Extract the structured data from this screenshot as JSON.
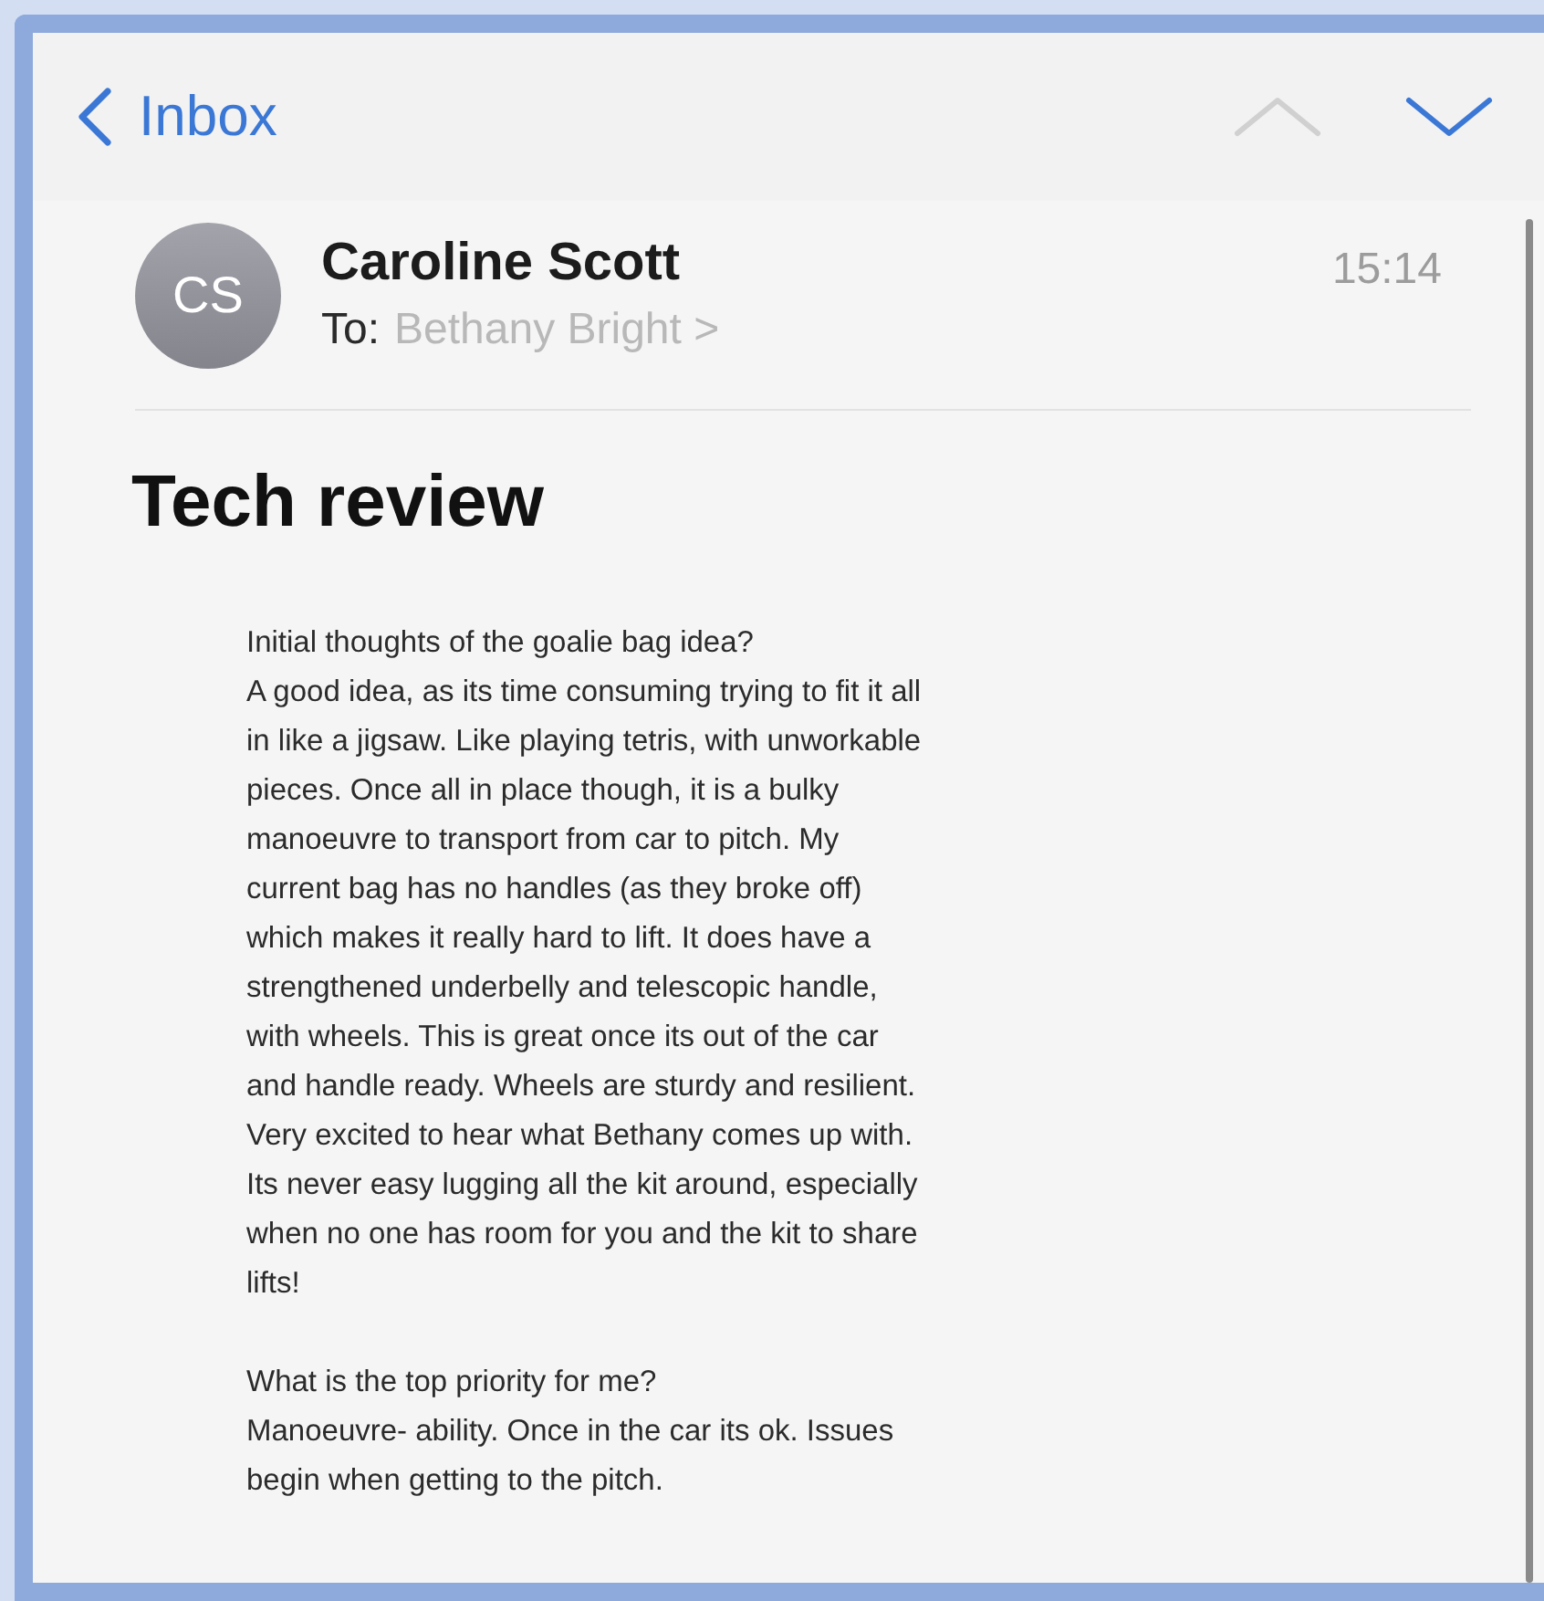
{
  "nav": {
    "back_label": "Inbox",
    "previous": {
      "disabled": true
    },
    "next": {
      "disabled": false
    }
  },
  "message": {
    "avatar_initials": "CS",
    "sender": "Caroline Scott",
    "to_label": "To:",
    "recipient": "Bethany Bright",
    "recipient_chevron": ">",
    "time": "15:14",
    "subject": "Tech review",
    "paragraphs": [
      {
        "lines": [
          "Initial thoughts of the goalie bag idea?",
          "A good idea, as its time consuming trying to fit it all",
          "in like a jigsaw. Like playing tetris, with unworkable",
          "pieces. Once all in place though, it is a bulky",
          "manoeuvre to transport from car to pitch. My",
          "current bag has no handles (as they broke off)",
          "which makes it really hard to lift. It does have a",
          "strengthened underbelly and telescopic handle,",
          "with wheels. This is great once its out of the car",
          "and handle ready. Wheels are sturdy and resilient.",
          "Very excited to hear what Bethany comes up with.",
          "Its never easy lugging all the kit around, especially",
          "when no one has room for you and the kit to share",
          "lifts!"
        ]
      },
      {
        "lines": [
          "What is the top priority for me?",
          "Manoeuvre- ability. Once in the car its ok. Issues",
          "begin when getting to the pitch."
        ]
      }
    ]
  }
}
